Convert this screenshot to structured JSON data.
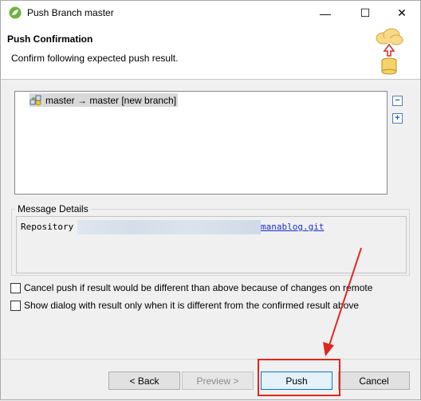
{
  "window": {
    "title": "Push Branch master",
    "controls": {
      "minimize": "—",
      "maximize": "☐",
      "close": "✕"
    }
  },
  "header": {
    "title": "Push Confirmation",
    "description": "Confirm following expected push result."
  },
  "tree": {
    "items": [
      {
        "label": "master → master [new branch]",
        "icon": "branch-push-icon"
      }
    ],
    "side_controls": {
      "collapse": "−",
      "expand": "+"
    }
  },
  "message_details": {
    "label": "Message Details",
    "key": "Repository",
    "link_text": "manablog.git"
  },
  "options": {
    "cancel_if_different": "Cancel push if result would be different than above because of changes on remote",
    "show_dialog_when_different": "Show dialog with result only when it is different from the confirmed result above"
  },
  "buttons": {
    "back": "< Back",
    "preview": "Preview >",
    "push": "Push",
    "cancel": "Cancel"
  },
  "colors": {
    "annotation": "#e0261c",
    "link": "#1a2fcc",
    "default_button_border": "#0078d7"
  }
}
